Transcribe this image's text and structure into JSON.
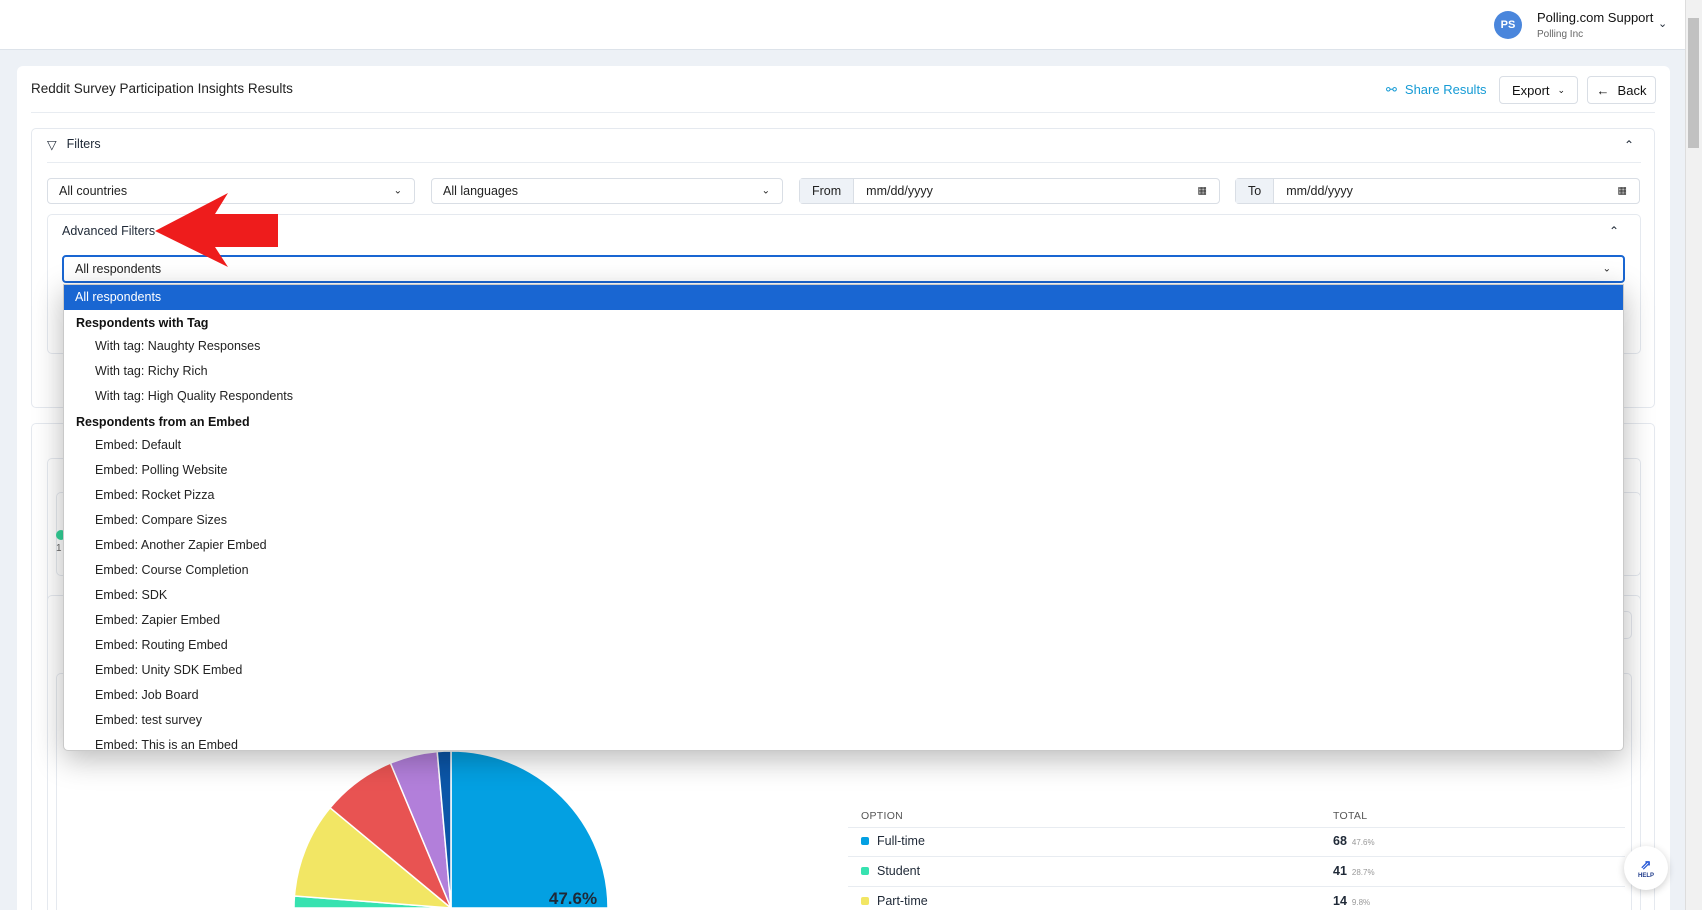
{
  "header": {
    "avatar_initials": "PS",
    "user_name": "Polling.com Support",
    "org": "Polling Inc"
  },
  "page": {
    "title": "Reddit Survey Participation Insights Results",
    "share_label": "Share Results",
    "export_label": "Export",
    "back_label": "Back"
  },
  "filters": {
    "title": "Filters",
    "country": "All countries",
    "language": "All languages",
    "from_label": "From",
    "from_placeholder": "mm/dd/yyyy",
    "to_label": "To",
    "to_placeholder": "mm/dd/yyyy"
  },
  "advanced": {
    "title": "Advanced Filters",
    "selected": "All respondents",
    "options": {
      "all": "All respondents",
      "tag_group": "Respondents with Tag",
      "tags": [
        "With tag: Naughty Responses",
        "With tag: Richy Rich",
        "With tag: High Quality Respondents"
      ],
      "embed_group": "Respondents from an Embed",
      "embeds": [
        "Embed: Default",
        "Embed: Polling Website",
        "Embed: Rocket Pizza",
        "Embed: Compare Sizes",
        "Embed: Another Zapier Embed",
        "Embed: Course Completion",
        "Embed: SDK",
        "Embed: Zapier Embed",
        "Embed: Routing Embed",
        "Embed: Unity SDK Embed",
        "Embed: Job Board",
        "Embed: test survey",
        "Embed: This is an Embed"
      ]
    }
  },
  "background_card": {
    "partial_text": "1"
  },
  "chart_data": {
    "type": "pie",
    "slices": [
      {
        "name": "Full-time",
        "value": 47.6,
        "color": "#03a0e2"
      },
      {
        "name": "Student",
        "value": 28.7,
        "color": "#37e2b0"
      },
      {
        "name": "Part-time",
        "value": 9.8,
        "color": "#f2e664"
      },
      {
        "name": "",
        "value": 7.7,
        "color": "#e85352"
      },
      {
        "name": "",
        "value": 4.9,
        "color": "#b27fda"
      },
      {
        "name": "",
        "value": 1.4,
        "color": "#0b56a8"
      }
    ],
    "visible_label": "47.6%"
  },
  "table": {
    "headers": [
      "OPTION",
      "TOTAL"
    ],
    "rows": [
      {
        "option": "Full-time",
        "total": "68",
        "pct": "47.6%",
        "color": "#03a0e2"
      },
      {
        "option": "Student",
        "total": "41",
        "pct": "28.7%",
        "color": "#37e2b0"
      },
      {
        "option": "Part-time",
        "total": "14",
        "pct": "9.8%",
        "color": "#f2e664"
      }
    ]
  },
  "help": {
    "label": "HELP"
  },
  "annotation": {
    "arrow_color": "#ee1c1c"
  }
}
